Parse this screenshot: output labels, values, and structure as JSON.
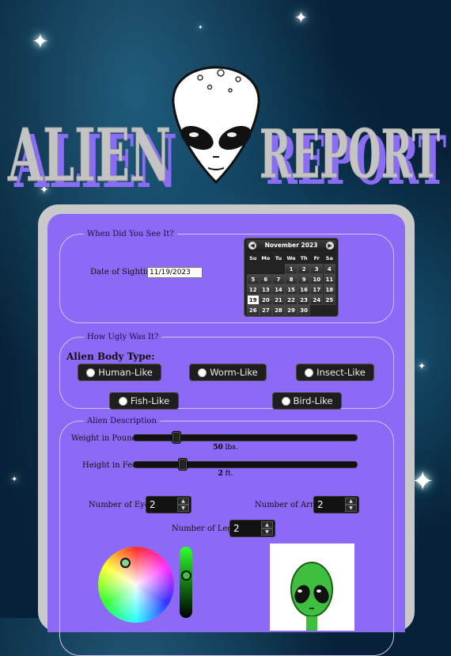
{
  "banner": {
    "word1": "ALIEN",
    "word2": "REPORT"
  },
  "sighting": {
    "legend": "When Did You See It?",
    "date_label": "Date of Sighting:",
    "date_value": "11/19/2023",
    "calendar": {
      "month_title": "November 2023",
      "weekdays": [
        "Su",
        "Mo",
        "Tu",
        "We",
        "Th",
        "Fr",
        "Sa"
      ],
      "weeks": [
        [
          "",
          "",
          "",
          "1",
          "2",
          "3",
          "4"
        ],
        [
          "5",
          "6",
          "7",
          "8",
          "9",
          "10",
          "11"
        ],
        [
          "12",
          "13",
          "14",
          "15",
          "16",
          "17",
          "18"
        ],
        [
          "19",
          "20",
          "21",
          "22",
          "23",
          "24",
          "25"
        ],
        [
          "26",
          "27",
          "28",
          "29",
          "30",
          "",
          ""
        ]
      ],
      "selected": "19"
    }
  },
  "ugly": {
    "legend": "How Ugly Was It?",
    "body_type_label": "Alien Body Type:",
    "options": [
      "Human-Like",
      "Worm-Like",
      "Insect-Like",
      "Fish-Like",
      "Bird-Like"
    ]
  },
  "description": {
    "legend": "Alien Description",
    "weight": {
      "label": "Weight in Pounds:",
      "value": "50",
      "unit": "lbs.",
      "fraction": 0.17
    },
    "height": {
      "label": "Height in Feet:",
      "value": "2",
      "unit": "ft.",
      "fraction": 0.2
    },
    "eyes": {
      "label": "Number of Eyes:",
      "value": "2"
    },
    "arms": {
      "label": "Number of Arms:",
      "value": "2"
    },
    "legs": {
      "label": "Number of Legs:",
      "value": "2"
    },
    "color_hex": "#3fbf3f"
  },
  "colors": {
    "panel": "#8c6af5",
    "panel_border": "#c9c9c9",
    "banner_shadow": "#8b6cf5"
  }
}
